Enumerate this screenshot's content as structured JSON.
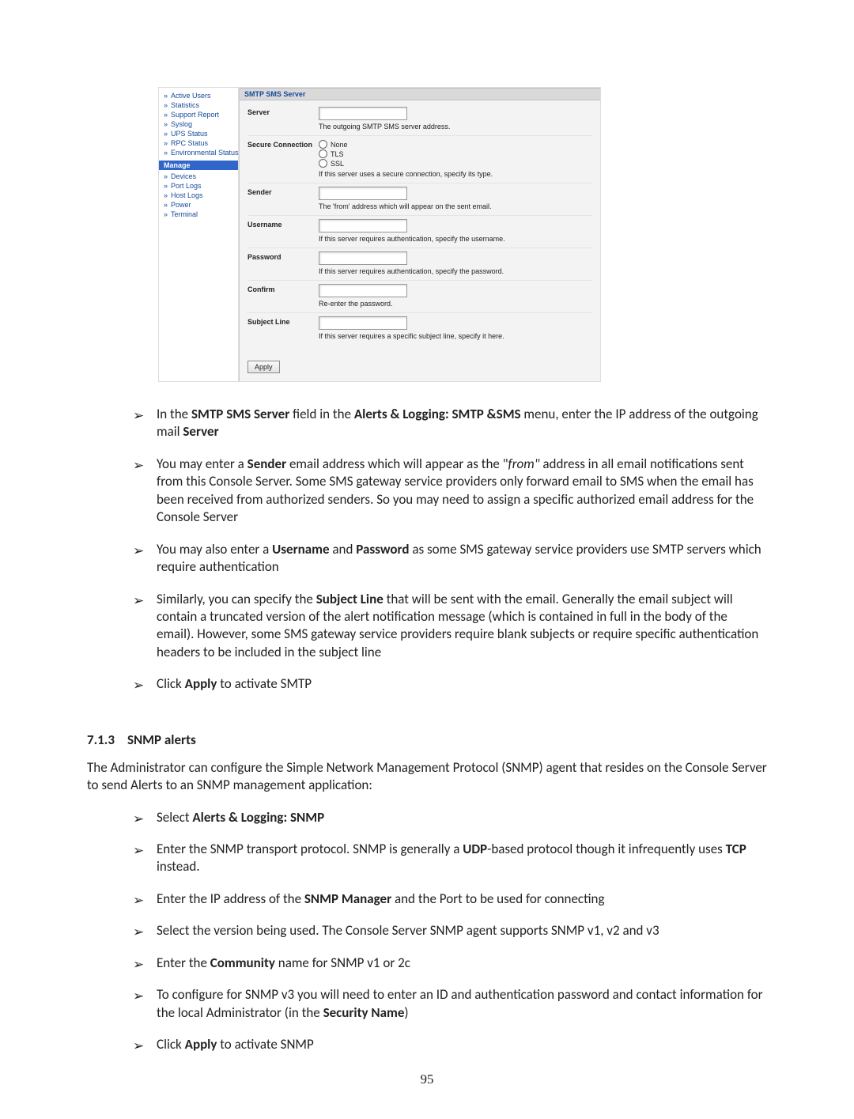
{
  "sidebar": {
    "top_items": [
      "Active Users",
      "Statistics",
      "Support Report",
      "Syslog",
      "UPS Status",
      "RPC Status",
      "Environmental Status"
    ],
    "section_label": "Manage",
    "bottom_items": [
      "Devices",
      "Port Logs",
      "Host Logs",
      "Power",
      "Terminal"
    ]
  },
  "panel": {
    "title": "SMTP SMS Server",
    "rows": {
      "server": {
        "label": "Server",
        "hint": "The outgoing SMTP SMS server address."
      },
      "secure": {
        "label": "Secure Connection",
        "hint": "If this server uses a secure connection, specify its type.",
        "options": [
          "None",
          "TLS",
          "SSL"
        ]
      },
      "sender": {
        "label": "Sender",
        "hint": "The 'from' address which will appear on the sent email."
      },
      "user": {
        "label": "Username",
        "hint": "If this server requires authentication, specify the username."
      },
      "pass": {
        "label": "Password",
        "hint": "If this server requires authentication, specify the password."
      },
      "confirm": {
        "label": "Confirm",
        "hint": "Re-enter the password."
      },
      "subject": {
        "label": "Subject Line",
        "hint": "If this server requires a specific subject line, specify it here."
      }
    },
    "apply": "Apply"
  },
  "bullets1": [
    {
      "html": "In the <b>SMTP SMS Server</b> field in the <b>Alerts & Logging: SMTP &SMS</b> menu, enter the IP address of the outgoing mail <b>Server</b>"
    },
    {
      "html": "You may enter a <b>Sender</b> email address which will appear as the \"<i>from\"</i> address in all email notifications sent from this Console Server. Some SMS gateway service providers only forward email to SMS when the email has been received from authorized senders. So you may need to assign a specific authorized email address for the Console Server"
    },
    {
      "html": "You may also enter a <b>Username</b> and <b>Password</b> as some SMS gateway service providers use SMTP servers which require authentication"
    },
    {
      "html": "Similarly, you can specify the <b>Subject Line</b> that will be sent with the email. Generally the email subject will contain a truncated version of the alert notification message (which is contained in full in the body of the email). However, some SMS gateway service providers require blank subjects or require specific authentication headers to be included in the subject line"
    },
    {
      "html": "Click <b>Apply</b> to activate SMTP"
    }
  ],
  "subheading": {
    "num": "7.1.3",
    "text": "SNMP alerts"
  },
  "para1": "The Administrator can configure the Simple Network Management Protocol (SNMP) agent that resides on the Console Server to send Alerts to an SNMP management application:",
  "bullets2": [
    {
      "html": "Select <b>Alerts & Logging: SNMP</b>"
    },
    {
      "html": "Enter the SNMP transport protocol. SNMP is generally a <b>UDP</b>-based protocol though it infrequently uses <b>TCP</b> instead."
    },
    {
      "html": "Enter the IP address of the <b>SNMP Manager</b> and the Port to be used for connecting"
    },
    {
      "html": "Select the version being used. The Console Server SNMP agent supports SNMP v1, v2 and v3"
    },
    {
      "html": "Enter the <b>Community</b> name for SNMP v1 or 2c"
    },
    {
      "html": "To configure for SNMP v3 you will need to enter an ID and authentication password and contact information for the local Administrator (in the <b>Security Name</b>)"
    },
    {
      "html": "Click <b>Apply</b> to activate SNMP"
    }
  ],
  "page_no": "95"
}
